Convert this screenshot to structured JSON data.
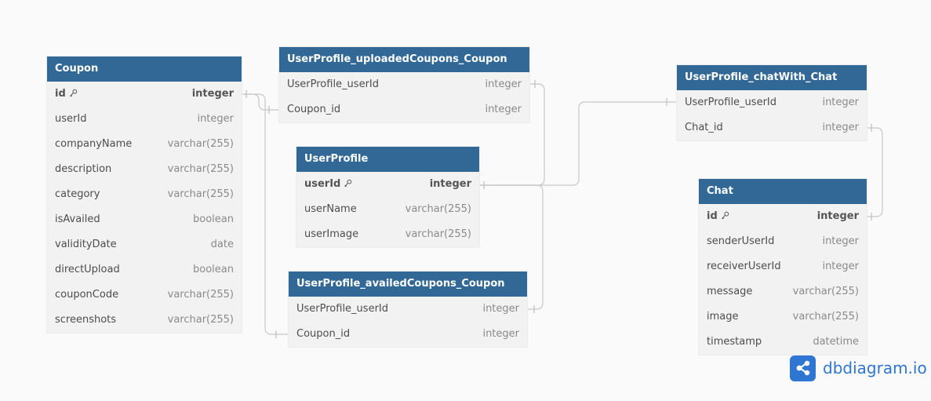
{
  "tables": {
    "coupon": {
      "name": "Coupon",
      "fields": [
        {
          "name": "id",
          "type": "integer",
          "pk": true
        },
        {
          "name": "userId",
          "type": "integer"
        },
        {
          "name": "companyName",
          "type": "varchar(255)"
        },
        {
          "name": "description",
          "type": "varchar(255)"
        },
        {
          "name": "category",
          "type": "varchar(255)"
        },
        {
          "name": "isAvailed",
          "type": "boolean"
        },
        {
          "name": "validityDate",
          "type": "date"
        },
        {
          "name": "directUpload",
          "type": "boolean"
        },
        {
          "name": "couponCode",
          "type": "varchar(255)"
        },
        {
          "name": "screenshots",
          "type": "varchar(255)"
        }
      ]
    },
    "uploaded": {
      "name": "UserProfile_uploadedCoupons_Coupon",
      "fields": [
        {
          "name": "UserProfile_userId",
          "type": "integer"
        },
        {
          "name": "Coupon_id",
          "type": "integer"
        }
      ]
    },
    "userprofile": {
      "name": "UserProfile",
      "fields": [
        {
          "name": "userId",
          "type": "integer",
          "pk": true
        },
        {
          "name": "userName",
          "type": "varchar(255)"
        },
        {
          "name": "userImage",
          "type": "varchar(255)"
        }
      ]
    },
    "availed": {
      "name": "UserProfile_availedCoupons_Coupon",
      "fields": [
        {
          "name": "UserProfile_userId",
          "type": "integer"
        },
        {
          "name": "Coupon_id",
          "type": "integer"
        }
      ]
    },
    "chatwith": {
      "name": "UserProfile_chatWith_Chat",
      "fields": [
        {
          "name": "UserProfile_userId",
          "type": "integer"
        },
        {
          "name": "Chat_id",
          "type": "integer"
        }
      ]
    },
    "chat": {
      "name": "Chat",
      "fields": [
        {
          "name": "id",
          "type": "integer",
          "pk": true
        },
        {
          "name": "senderUserId",
          "type": "integer"
        },
        {
          "name": "receiverUserId",
          "type": "integer"
        },
        {
          "name": "message",
          "type": "varchar(255)"
        },
        {
          "name": "image",
          "type": "varchar(255)"
        },
        {
          "name": "timestamp",
          "type": "datetime"
        }
      ]
    }
  },
  "logo": {
    "text": "dbdiagram.io",
    "icon": "share-network-icon"
  },
  "colors": {
    "header": "#316896",
    "body": "#f2f2f2",
    "connector": "#c8c8c8",
    "brand": "#2f76d2"
  }
}
